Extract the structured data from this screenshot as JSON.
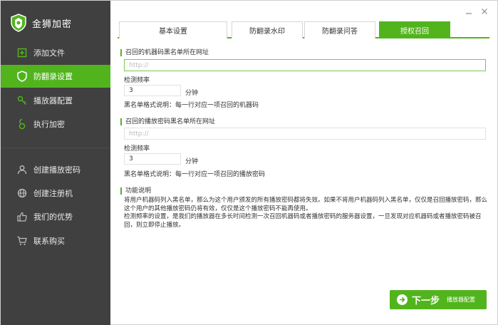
{
  "app": {
    "title": "金狮加密"
  },
  "sidebar": {
    "items": [
      {
        "label": "添加文件",
        "icon": "add-file-icon"
      },
      {
        "label": "防翻录设置",
        "icon": "shield-icon",
        "active": true
      },
      {
        "label": "播放器配置",
        "icon": "key-icon"
      },
      {
        "label": "执行加密",
        "icon": "lock-icon"
      },
      {
        "label": "创建播放密码",
        "icon": "user-icon"
      },
      {
        "label": "创建注册机",
        "icon": "globe-icon"
      },
      {
        "label": "我们的优势",
        "icon": "thumbs-up-icon"
      },
      {
        "label": "联系购买",
        "icon": "cart-icon"
      }
    ]
  },
  "tabs": [
    {
      "label": "基本设置"
    },
    {
      "label": "防翻录水印"
    },
    {
      "label": "防翻录问答"
    },
    {
      "label": "授权召回",
      "active": true
    }
  ],
  "machine_section": {
    "title": "召回的机器码黑名单所在网址",
    "url_placeholder": "http://",
    "freq_label": "检测频率",
    "freq_value": "3",
    "freq_unit": "分钟",
    "format_note": "黑名单格式说明：每一行对应一项召回的机器码"
  },
  "password_section": {
    "title": "召回的播放密码黑名单所在网址",
    "url_placeholder": "http://",
    "freq_label": "检测频率",
    "freq_value": "3",
    "freq_unit": "分钟",
    "format_note": "黑名单格式说明：每一行对应一项召回的播放密码"
  },
  "function_section": {
    "title": "功能说明",
    "paragraph1": "将用户机器码列入黑名单，那么为这个用户颁发的所有播放密码都将失效。如果不将用户机器码列入黑名单，仅仅是召回播放密码，那么这个用户的其他播放密码仍将有效，仅仅是这个播放密码不能再使用。",
    "paragraph2": "检测频率的设置，是我们的播放器在多长时间检测一次召回机器码或者播放密码的服务器设置，一旦发现对应机器码或者播放密码被召回，则立即停止播放。"
  },
  "footer": {
    "next_label": "下一步",
    "next_sub": "播放器配置"
  },
  "colors": {
    "accent": "#52b41d",
    "sidebar_bg": "#404040"
  }
}
